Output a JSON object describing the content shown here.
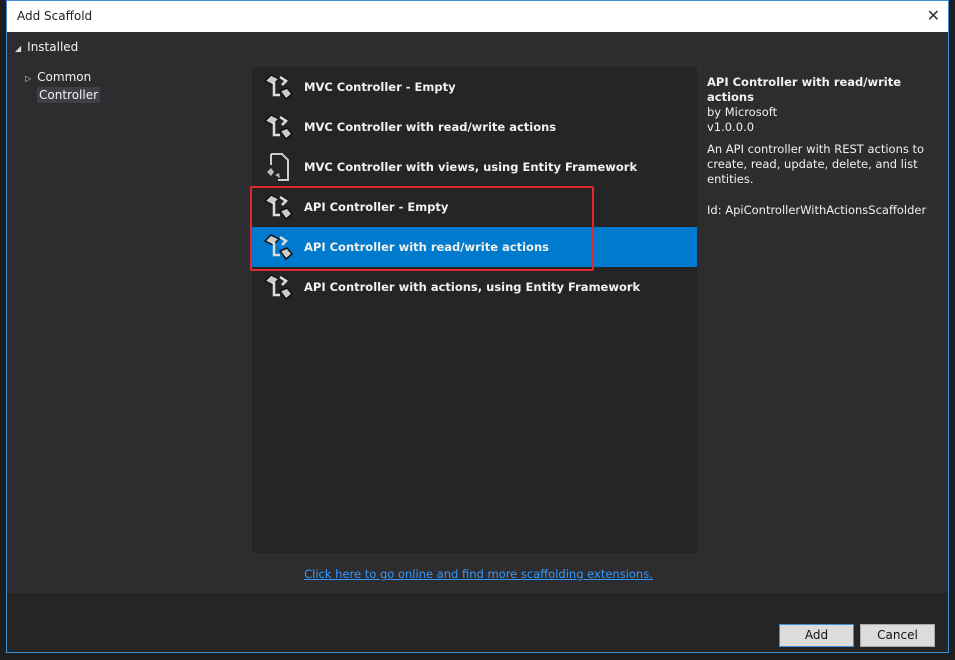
{
  "window": {
    "title": "Add Scaffold",
    "close": "✕"
  },
  "tree": {
    "root": "Installed",
    "items": [
      {
        "label": "Common"
      },
      {
        "label": "Controller"
      }
    ]
  },
  "templates": [
    {
      "label": "MVC Controller - Empty",
      "icon": "controller-icon"
    },
    {
      "label": "MVC Controller with read/write actions",
      "icon": "controller-icon"
    },
    {
      "label": "MVC Controller with views, using Entity Framework",
      "icon": "file-controller-icon"
    },
    {
      "label": "API Controller - Empty",
      "icon": "controller-icon"
    },
    {
      "label": "API Controller with read/write actions",
      "icon": "controller-icon",
      "selected": true
    },
    {
      "label": "API Controller with actions, using Entity Framework",
      "icon": "controller-icon"
    }
  ],
  "details": {
    "title": "API Controller with read/write actions",
    "author": "by Microsoft",
    "version": "v1.0.0.0",
    "description": "An API controller with REST actions to create, read, update, delete, and list entities.",
    "id": "Id: ApiControllerWithActionsScaffolder"
  },
  "link": "Click here to go online and find more scaffolding extensions.",
  "buttons": {
    "add": "Add",
    "cancel": "Cancel"
  },
  "colors": {
    "accent": "#007acc",
    "highlight": "#e0282d"
  }
}
